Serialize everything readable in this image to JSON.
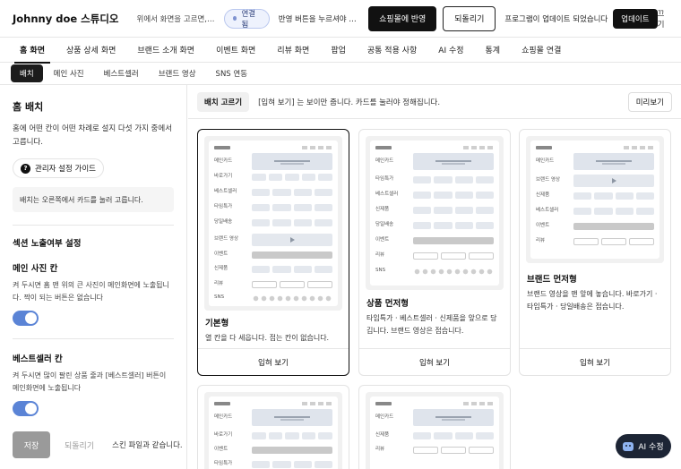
{
  "topbar": {
    "brand": "Johnny doe 스튜디오",
    "hint": "위에서 화면을 고르면, 오른쪽에서 바꿀 수 있어요",
    "connection": "연결됨",
    "apply_hint": "반영 버튼을 누르셔야 스튜디오 내용이 반영됩니다",
    "apply_button": "쇼핑몰에 반영",
    "revert_button": "되돌리기",
    "update_message": "프로그램이 업데이트 되었습니다",
    "update_button": "업데이트",
    "close_link": "끄기"
  },
  "main_tabs": [
    {
      "label": "홈 화면",
      "active": true
    },
    {
      "label": "상품 상세 화면"
    },
    {
      "label": "브랜드 소개 화면"
    },
    {
      "label": "이벤트 화면"
    },
    {
      "label": "리뷰 화면"
    },
    {
      "label": "팝업"
    },
    {
      "label": "공통 적용 사항"
    },
    {
      "label": "AI 수정"
    },
    {
      "label": "통계"
    },
    {
      "label": "쇼핑몰 연결"
    }
  ],
  "sub_tabs": [
    {
      "label": "배치",
      "active": true
    },
    {
      "label": "메인 사진"
    },
    {
      "label": "베스트셀러"
    },
    {
      "label": "브랜드 영상"
    },
    {
      "label": "SNS 연동"
    }
  ],
  "left_panel": {
    "title": "홈 배치",
    "description": "홈에 어떤 칸이 어떤 차례로 설지 다섯 가지 중에서 고릅니다.",
    "guide_button": "관리자 설정 가이드",
    "note": "배치는 오른쪽에서 카드를 눌러 고릅니다.",
    "section_title": "섹션 노출여부 설정",
    "items": [
      {
        "title": "메인 사진 칸",
        "description": "켜 두시면 홈 맨 위의 큰 사진이 메인화면에 노출됩니다. 짝이 되는 버튼은 없습니다",
        "enabled": true
      },
      {
        "title": "베스트셀러 칸",
        "description": "켜 두시면 많이 팔린 상품 줄과 [베스트셀러] 버튼이 메인화면에 노출됩니다",
        "enabled": true
      }
    ],
    "save_button": "저장",
    "revert_link": "되돌리기",
    "skin_note": "스킨 파일과 같습니다."
  },
  "toolbar": {
    "label": "배치 고르기",
    "hint": "[입혀 보기] 는 보이만 줍니다. 카드를 눌러야 정해집니다.",
    "preview_button": "미리보기"
  },
  "layout_cards": [
    {
      "title": "기본형",
      "description": "열 칸을 다 세웁니다. 접는 칸이 없습니다.",
      "action": "입혀 보기",
      "selected": true,
      "rows": [
        "메인카드",
        "바로가기",
        "베스트셀러",
        "타임특가",
        "당일배송",
        "브랜드 영상",
        "이벤트",
        "신제품",
        "리뷰",
        "SNS"
      ]
    },
    {
      "title": "상품 먼저형",
      "description": "타임특가 · 베스트셀러 · 신제품을 앞으로 당깁니다. 브랜드 영상은 접습니다.",
      "action": "입혀 보기",
      "selected": false,
      "rows": [
        "메인카드",
        "타임특가",
        "베스트셀러",
        "신제품",
        "당일배송",
        "이벤트",
        "리뷰",
        "SNS"
      ]
    },
    {
      "title": "브랜드 먼저형",
      "description": "브랜드 영상을 맨 앞에 놓습니다. 바로가기 · 타임특가 · 당일배송은 접습니다.",
      "action": "입혀 보기",
      "selected": false,
      "rows": [
        "메인카드",
        "브랜드 영상",
        "신제품",
        "베스트셀러",
        "이벤트",
        "리뷰"
      ]
    },
    {
      "rows": [
        "메인카드",
        "바로가기",
        "이벤트",
        "타임특가"
      ]
    },
    {
      "rows": [
        "메인카드",
        "신제품",
        "리뷰"
      ]
    }
  ],
  "ai_fab": "AI 수정"
}
